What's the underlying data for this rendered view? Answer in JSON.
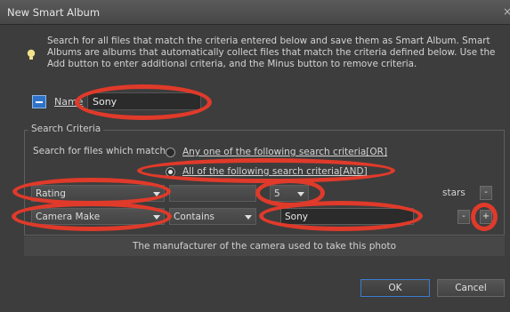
{
  "window": {
    "title": "New Smart Album",
    "close_glyph": "×"
  },
  "info": {
    "icon": "lightbulb-icon",
    "text": "Search for all files that match the criteria entered below and save them as Smart Album. Smart Albums are albums that automatically collect files that match the criteria defined below. Use the Add button to enter additional criteria, and the Minus button to remove criteria."
  },
  "name": {
    "label": "Name",
    "value": "Sony"
  },
  "criteria": {
    "legend": "Search Criteria",
    "match_label": "Search for files which match:",
    "option_any": "Any one of the following search criteria[OR]",
    "option_all": "All of the following search criteria[AND]",
    "selected": "all",
    "rows": [
      {
        "field": "Rating",
        "operator": "",
        "value": "5",
        "suffix": "stars",
        "minus": "-"
      },
      {
        "field": "Camera Make",
        "operator": "Contains",
        "value": "Sony",
        "minus": "-",
        "plus": "+"
      }
    ],
    "description": "The manufacturer of the camera used to take this photo"
  },
  "buttons": {
    "ok": "OK",
    "cancel": "Cancel"
  },
  "colors": {
    "annotation": "#e03a2a",
    "accent": "#2f73c8"
  }
}
